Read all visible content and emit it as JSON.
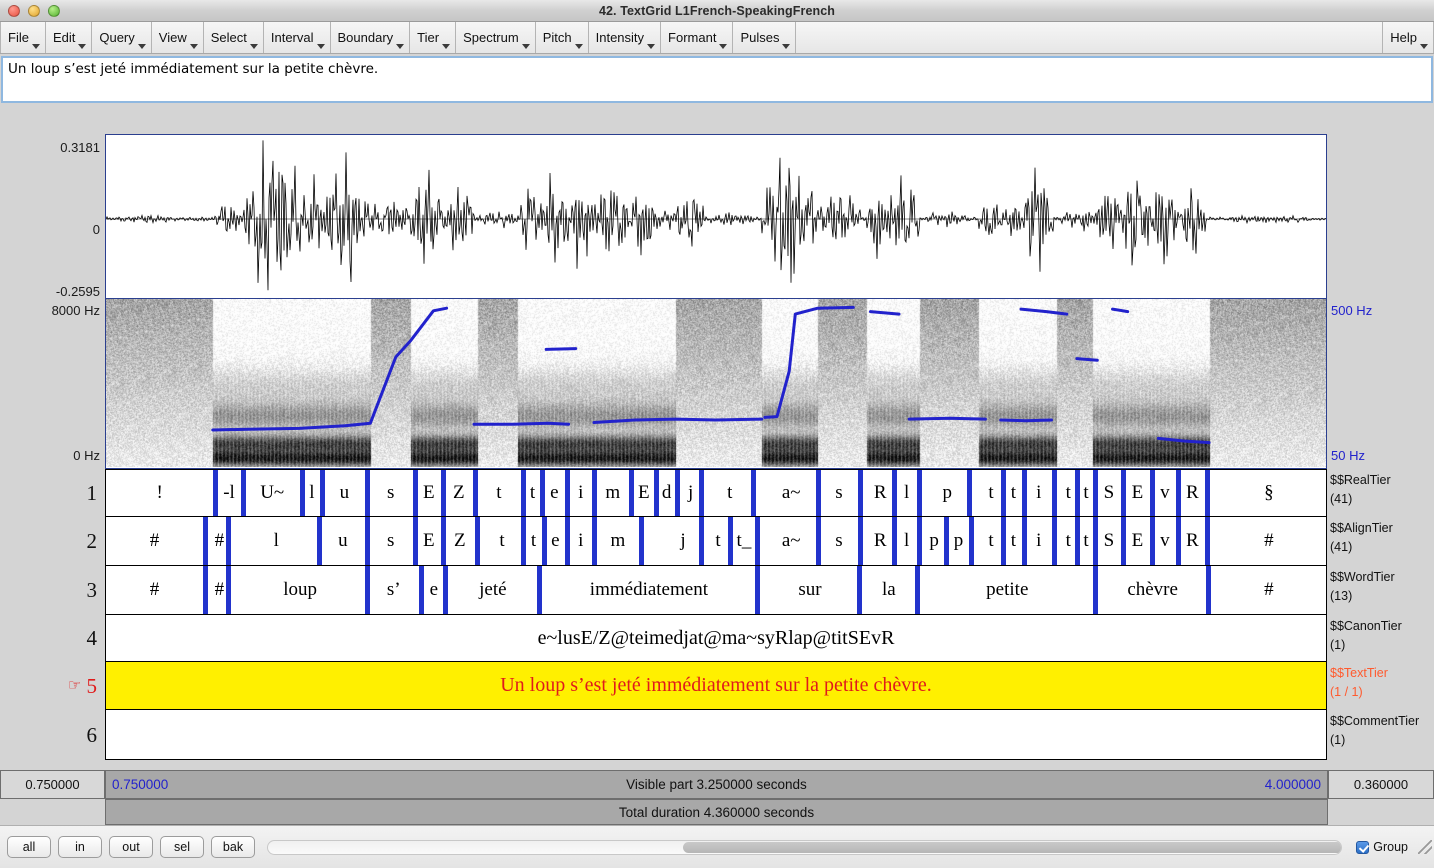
{
  "window": {
    "title": "42. TextGrid L1French-SpeakingFrench",
    "traffic_lights": [
      "close-button",
      "minimize-button",
      "zoom-button"
    ]
  },
  "menubar": {
    "items": [
      {
        "label": "File"
      },
      {
        "label": "Edit"
      },
      {
        "label": "Query"
      },
      {
        "label": "View"
      },
      {
        "label": "Select"
      },
      {
        "label": "Interval"
      },
      {
        "label": "Boundary"
      },
      {
        "label": "Tier"
      },
      {
        "label": "Spectrum"
      },
      {
        "label": "Pitch"
      },
      {
        "label": "Intensity"
      },
      {
        "label": "Formant"
      },
      {
        "label": "Pulses"
      }
    ],
    "help": {
      "label": "Help"
    }
  },
  "text_field": {
    "value": "Un loup s’est jeté immédiatement sur la petite chèvre.",
    "placeholder": ""
  },
  "waveform": {
    "max_label": "0.3181",
    "zero_label": "0",
    "min_label": "-0.2595"
  },
  "spectrogram": {
    "top_label": "8000 Hz",
    "bottom_label": "0 Hz",
    "pitch_top_label": "500 Hz",
    "pitch_bottom_label": "50 Hz",
    "pitch_color": "#2222cc"
  },
  "tiers": [
    {
      "number": "1",
      "name": "$$RealTier",
      "count": "(41)",
      "selected": false,
      "mode": "intervals",
      "cells": [
        {
          "label": "!",
          "start": 0.0,
          "end": 0.1055
        },
        {
          "label": "-l",
          "start": 0.1095,
          "end": 0.1325
        },
        {
          "label": "U~",
          "start": 0.1365,
          "end": 0.1905
        },
        {
          "label": "l",
          "start": 0.1945,
          "end": 0.2105
        },
        {
          "label": "u",
          "start": 0.2145,
          "end": 0.2545
        },
        {
          "label": "s",
          "start": 0.2585,
          "end": 0.3015
        },
        {
          "label": "E",
          "start": 0.3055,
          "end": 0.3295
        },
        {
          "label": "Z",
          "start": 0.3335,
          "end": 0.3605
        },
        {
          "label": "t",
          "start": 0.3645,
          "end": 0.4085
        },
        {
          "label": "t",
          "start": 0.4125,
          "end": 0.4265
        },
        {
          "label": "e",
          "start": 0.4305,
          "end": 0.4515
        },
        {
          "label": "i",
          "start": 0.4555,
          "end": 0.4785
        },
        {
          "label": "m",
          "start": 0.4825,
          "end": 0.5145
        },
        {
          "label": "E",
          "start": 0.5185,
          "end": 0.5395
        },
        {
          "label": "d",
          "start": 0.5435,
          "end": 0.5595
        },
        {
          "label": "j",
          "start": 0.5665,
          "end": 0.5835
        },
        {
          "label": "t",
          "start": 0.5925,
          "end": 0.6345
        },
        {
          "label": "a~",
          "start": 0.6495,
          "end": 0.6985
        },
        {
          "label": "s",
          "start": 0.7025,
          "end": 0.7395
        },
        {
          "label": "R",
          "start": 0.7495,
          "end": 0.7735
        },
        {
          "label": "l",
          "start": 0.7775,
          "end": 0.7975
        },
        {
          "label": "p",
          "start": 0.8085,
          "end": 0.8465
        },
        {
          "label": "t",
          "start": 0.8605,
          "end": 0.8805
        },
        {
          "label": "t",
          "start": 0.8845,
          "end": 0.9005
        },
        {
          "label": "i",
          "start": 0.9045,
          "end": 0.9305
        },
        {
          "label": "t",
          "start": 0.9395,
          "end": 0.9535
        },
        {
          "label": "t",
          "start": 0.9575,
          "end": 0.9705
        },
        {
          "label": "S",
          "start": 0.9745,
          "end": 0.9985
        },
        {
          "label": "E",
          "start": 1.0025,
          "end": 1.0265
        },
        {
          "label": "v",
          "start": 1.0305,
          "end": 1.0525
        },
        {
          "label": "R",
          "start": 1.0565,
          "end": 1.0805
        },
        {
          "label": "§",
          "start": 1.0875,
          "end": 1.2
        }
      ]
    },
    {
      "number": "2",
      "name": "$$AlignTier",
      "count": "(41)",
      "selected": false,
      "mode": "intervals",
      "cells": [
        {
          "label": "#",
          "start": 0.0,
          "end": 0.0955
        },
        {
          "label": "#",
          "start": 0.1045,
          "end": 0.1185
        },
        {
          "label": "l",
          "start": 0.1275,
          "end": 0.2075
        },
        {
          "label": "u",
          "start": 0.2115,
          "end": 0.2545
        },
        {
          "label": "s",
          "start": 0.2585,
          "end": 0.3015
        },
        {
          "label": "E",
          "start": 0.3055,
          "end": 0.3295
        },
        {
          "label": "Z",
          "start": 0.3335,
          "end": 0.3625
        },
        {
          "label": "t",
          "start": 0.3705,
          "end": 0.4085
        },
        {
          "label": "t",
          "start": 0.4125,
          "end": 0.4285
        },
        {
          "label": "e",
          "start": 0.4325,
          "end": 0.4515
        },
        {
          "label": "i",
          "start": 0.4555,
          "end": 0.4785
        },
        {
          "label": "m",
          "start": 0.4825,
          "end": 0.5245
        },
        {
          "label": "j",
          "start": 0.5515,
          "end": 0.5835
        },
        {
          "label": "t",
          "start": 0.5925,
          "end": 0.6115
        },
        {
          "label": "t_",
          "start": 0.6165,
          "end": 0.6385
        },
        {
          "label": "a~",
          "start": 0.6495,
          "end": 0.6985
        },
        {
          "label": "s",
          "start": 0.7025,
          "end": 0.7395
        },
        {
          "label": "R",
          "start": 0.7495,
          "end": 0.7735
        },
        {
          "label": "l",
          "start": 0.7775,
          "end": 0.7975
        },
        {
          "label": "p",
          "start": 0.8045,
          "end": 0.8245
        },
        {
          "label": "p",
          "start": 0.8285,
          "end": 0.8485
        },
        {
          "label": "t",
          "start": 0.8605,
          "end": 0.8805
        },
        {
          "label": "t",
          "start": 0.8845,
          "end": 0.9005
        },
        {
          "label": "i",
          "start": 0.9045,
          "end": 0.9305
        },
        {
          "label": "t",
          "start": 0.9395,
          "end": 0.9535
        },
        {
          "label": "t",
          "start": 0.9575,
          "end": 0.9705
        },
        {
          "label": "S",
          "start": 0.9745,
          "end": 0.9985
        },
        {
          "label": "E",
          "start": 1.0025,
          "end": 1.0265
        },
        {
          "label": "v",
          "start": 1.0305,
          "end": 1.0525
        },
        {
          "label": "R",
          "start": 1.0565,
          "end": 1.0805
        },
        {
          "label": "#",
          "start": 1.0875,
          "end": 1.2
        }
      ]
    },
    {
      "number": "3",
      "name": "$$WordTier",
      "count": "(13)",
      "selected": false,
      "mode": "intervals",
      "cells": [
        {
          "label": "#",
          "start": 0.0,
          "end": 0.0955
        },
        {
          "label": "#",
          "start": 0.1045,
          "end": 0.1185
        },
        {
          "label": "loup",
          "start": 0.1275,
          "end": 0.2545
        },
        {
          "label": "s’",
          "start": 0.2585,
          "end": 0.3075
        },
        {
          "label": "e",
          "start": 0.3135,
          "end": 0.3315
        },
        {
          "label": "jeté",
          "start": 0.3375,
          "end": 0.4235
        },
        {
          "label": "immédiatement",
          "start": 0.4295,
          "end": 0.6385
        },
        {
          "label": "sur",
          "start": 0.6465,
          "end": 0.7385
        },
        {
          "label": "la",
          "start": 0.7445,
          "end": 0.7955
        },
        {
          "label": "petite",
          "start": 0.8025,
          "end": 0.9705
        },
        {
          "label": "chèvre",
          "start": 0.9775,
          "end": 1.0815
        },
        {
          "label": "#",
          "start": 1.0875,
          "end": 1.2
        }
      ]
    },
    {
      "number": "4",
      "name": "$$CanonTier",
      "count": "(1)",
      "selected": false,
      "mode": "single",
      "text": "e~lusE/Z@teimedjat@ma~syRlap@titSEvR"
    },
    {
      "number": "5",
      "name": "$$TextTier",
      "count": "(1 / 1)",
      "selected": true,
      "mode": "single",
      "text": "Un loup s’est jeté immédiatement sur la petite chèvre.",
      "pointer_icon": "☞",
      "highlight_color": "#fff000",
      "text_color": "#e01b1b"
    },
    {
      "number": "6",
      "name": "$$CommentTier",
      "count": "(1)",
      "selected": false,
      "mode": "single",
      "text": ""
    }
  ],
  "timebar": {
    "left_value": "0.750000",
    "start_time": "0.750000",
    "visible_part": "Visible part 3.250000 seconds",
    "end_time": "4.000000",
    "right_value": "0.360000",
    "total_duration": "Total duration 4.360000 seconds"
  },
  "bottom_bar": {
    "buttons": [
      {
        "label": "all"
      },
      {
        "label": "in"
      },
      {
        "label": "out"
      },
      {
        "label": "sel"
      },
      {
        "label": "bak"
      }
    ],
    "group": {
      "label": "Group",
      "checked": true
    }
  }
}
